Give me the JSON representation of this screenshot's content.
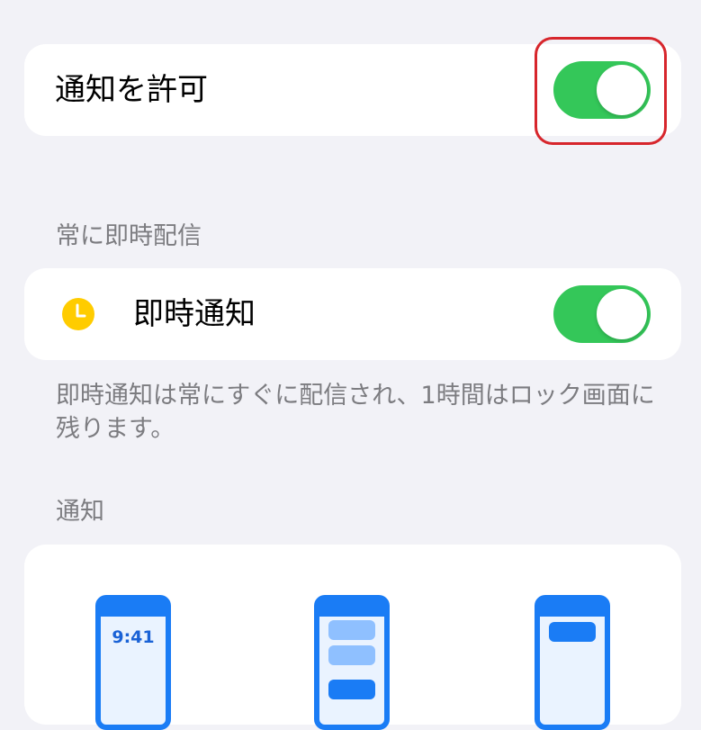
{
  "notifications": {
    "allow_label": "通知を許可",
    "allow_toggle_on": true
  },
  "delivery": {
    "section_header": "常に即時配信",
    "instant_label": "即時通知",
    "instant_toggle_on": true,
    "footer_note": "即時通知は常にすぐに配信され、1時間はロック画面に残ります。"
  },
  "alerts": {
    "section_header": "通知",
    "styles": [
      {
        "name": "lock-screen",
        "time": "9:41"
      },
      {
        "name": "notification-center"
      },
      {
        "name": "banners"
      }
    ]
  },
  "colors": {
    "toggle_on": "#34c759",
    "highlight": "#d7262c",
    "accent_blue": "#1a7cf5",
    "clock_icon": "#ffcc00"
  }
}
